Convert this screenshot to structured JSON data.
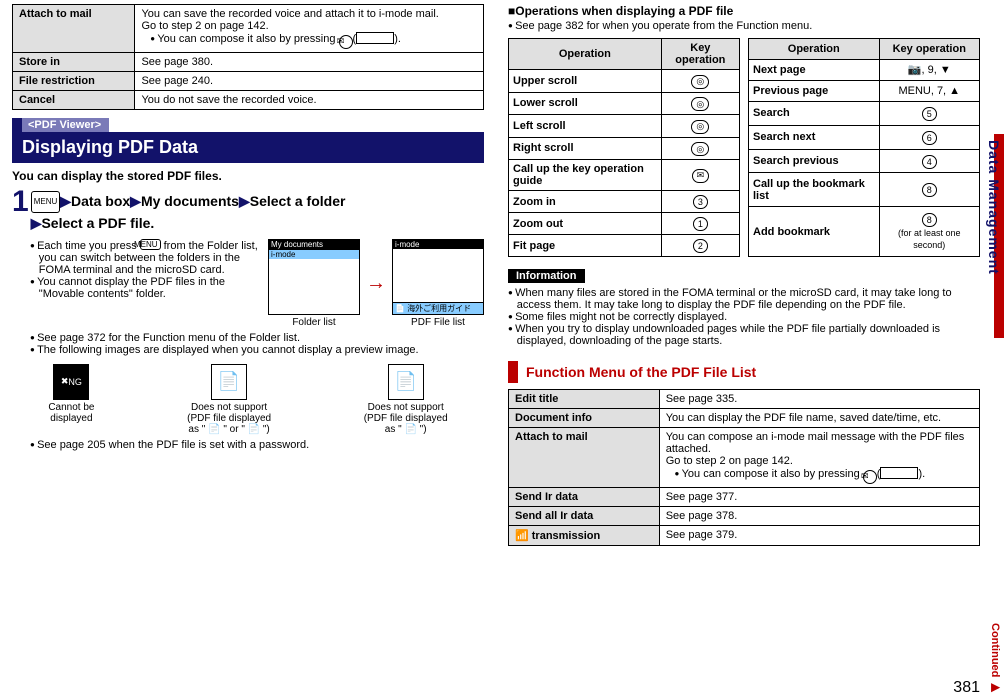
{
  "left": {
    "fn_rows": [
      {
        "label": "Attach to mail",
        "body": "You can save the recorded voice and attach it to i-mode mail.\nGo to step 2 on page 142.",
        "extra": "You can compose it also by pressing "
      },
      {
        "label": "Store in",
        "body": "See page 380."
      },
      {
        "label": "File restriction",
        "body": "See page 240."
      },
      {
        "label": "Cancel",
        "body": "You do not save the recorded voice."
      }
    ],
    "pdf_viewer_tag": "<PDF Viewer>",
    "pdf_viewer_title": "Displaying PDF Data",
    "pdf_intro": "You can display the stored PDF files.",
    "step_parts": [
      "Data box",
      "My documents",
      "Select a folder",
      "Select a PDF file."
    ],
    "notes_a": [
      "Each time you press ",
      "from the Folder list, you can switch between the folders in the FOMA terminal and the microSD card.",
      "You cannot display the PDF files in the \"Movable contents\" folder."
    ],
    "folder_label": "Folder list",
    "pdf_label": "PDF File list",
    "folder_caption": "My documents",
    "folder_item": "i-mode",
    "pdf_caption": "i-mode",
    "pdf_item": "海外ご利用ガイド",
    "notes_b": [
      "See page 372 for the Function menu of the Folder list.",
      "The following images are displayed when you cannot display a preview image."
    ],
    "thumbs": [
      {
        "icon": "NG",
        "lines": [
          "Cannot be",
          "displayed"
        ]
      },
      {
        "icon": "📄",
        "lines": [
          "Does not support",
          "(PDF file displayed",
          "as \" 📄 \" or \" 📄 \")"
        ]
      },
      {
        "icon": "📄",
        "lines": [
          "Does not support",
          "(PDF file displayed",
          "as \" 📄 \")"
        ]
      }
    ],
    "notes_c": "See page 205 when the PDF file is set with a password."
  },
  "right": {
    "ops_title": "Operations when displaying a PDF file",
    "ops_sub": "See page 382 for when you operate from the Function menu.",
    "op_headers": [
      "Operation",
      "Key operation"
    ],
    "ops_left": [
      {
        "lbl": "Upper scroll",
        "key": "◎"
      },
      {
        "lbl": "Lower scroll",
        "key": "◎"
      },
      {
        "lbl": "Left scroll",
        "key": "◎"
      },
      {
        "lbl": "Right scroll",
        "key": "◎"
      },
      {
        "lbl": "Call up the key operation guide",
        "key": "✉"
      },
      {
        "lbl": "Zoom in",
        "key": "3"
      },
      {
        "lbl": "Zoom out",
        "key": "1"
      },
      {
        "lbl": "Fit page",
        "key": "2"
      }
    ],
    "ops_right": [
      {
        "lbl": "Next page",
        "key": "📷, 9, ▼"
      },
      {
        "lbl": "Previous page",
        "key": "MENU, 7, ▲"
      },
      {
        "lbl": "Search",
        "key": "5"
      },
      {
        "lbl": "Search next",
        "key": "6"
      },
      {
        "lbl": "Search previous",
        "key": "4"
      },
      {
        "lbl": "Call up the bookmark list",
        "key": "8"
      },
      {
        "lbl": "Add bookmark",
        "key": "8",
        "note": "(for at least one second)"
      }
    ],
    "info_label": "Information",
    "info_items": [
      "When many files are stored in the FOMA terminal or the microSD card, it may take long to access them. It may take long to display the PDF file depending on the PDF file.",
      "Some files might not be correctly displayed.",
      "When you try to display undownloaded pages while the PDF file partially downloaded is displayed, downloading of the page starts."
    ],
    "func_title": "Function Menu of the PDF File List",
    "func_rows": [
      {
        "label": "Edit title",
        "body": "See page 335."
      },
      {
        "label": "Document info",
        "body": "You can display the PDF file name, saved date/time, etc."
      },
      {
        "label": "Attach to mail",
        "body": "You can compose an i-mode mail message with the PDF files attached.\nGo to step 2 on page 142.",
        "extra": "You can compose it also by pressing "
      },
      {
        "label": "Send Ir data",
        "body": "See page 377."
      },
      {
        "label": "Send all Ir data",
        "body": "See page 378."
      },
      {
        "label": "📶 transmission",
        "body": "See page 379."
      }
    ]
  },
  "side_tab": "Data Management",
  "continued": "Continued ▶",
  "page_num": "381"
}
